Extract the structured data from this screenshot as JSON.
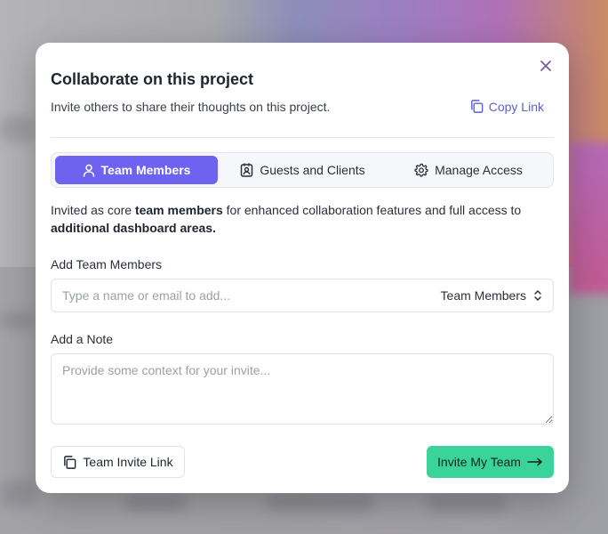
{
  "modal": {
    "title": "Collaborate on this project",
    "subtitle": "Invite others to share their thoughts on this project.",
    "copy_link_label": "Copy Link",
    "close_icon": "close-icon"
  },
  "tabs": [
    {
      "label": "Team Members",
      "icon": "user-icon",
      "active": true
    },
    {
      "label": "Guests and Clients",
      "icon": "contact-card-icon",
      "active": false
    },
    {
      "label": "Manage Access",
      "icon": "gear-icon",
      "active": false
    }
  ],
  "description": {
    "part1": "Invited as core ",
    "bold1": "team members",
    "part2": " for enhanced collaboration features and full access to ",
    "bold2": "additional dashboard areas."
  },
  "add_members": {
    "label": "Add Team Members",
    "placeholder": "Type a name or email to add...",
    "value": "",
    "role_selected": "Team Members"
  },
  "note": {
    "label": "Add a Note",
    "placeholder": "Provide some context for your invite...",
    "value": ""
  },
  "footer": {
    "invite_link_label": "Team Invite Link",
    "invite_button_label": "Invite My Team"
  },
  "colors": {
    "accent": "#6d63f0",
    "primary_button": "#3ad39a",
    "link": "#5b5fd6"
  }
}
